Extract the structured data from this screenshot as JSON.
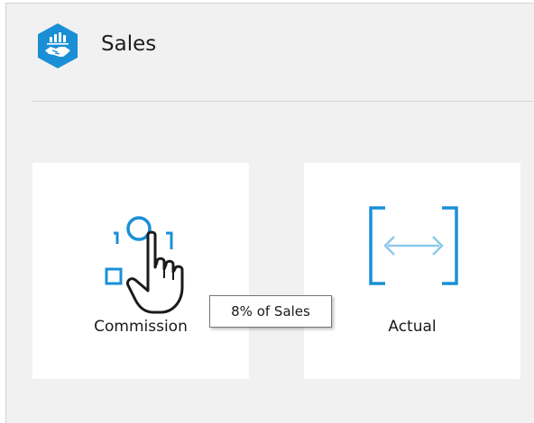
{
  "header": {
    "title": "Sales",
    "logo_icon": "sales-handshake-icon",
    "accent_color": "#1a8fd6"
  },
  "tiles": [
    {
      "label": "Commission",
      "icon": "selection-shape-icon"
    },
    {
      "label": "Actual",
      "icon": "bracket-arrows-icon"
    }
  ],
  "tooltip": {
    "text": "8% of Sales"
  },
  "cursor": {
    "icon": "hand-pointer-icon"
  }
}
